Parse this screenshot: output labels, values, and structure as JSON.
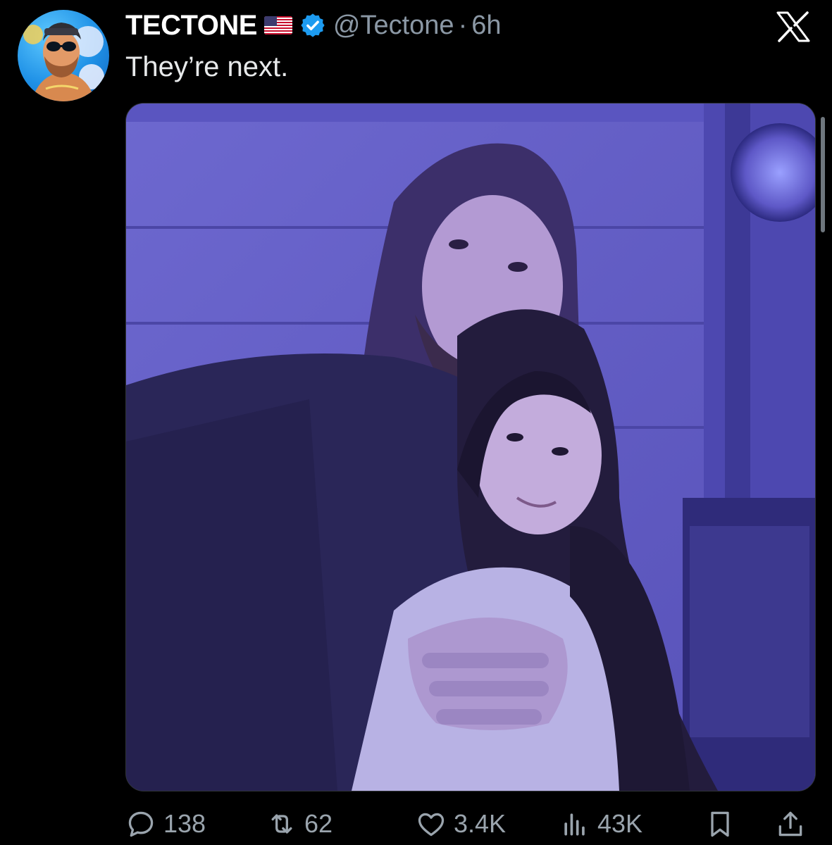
{
  "author": {
    "display_name": "TECTONE",
    "handle": "@Tectone",
    "separator": "·",
    "time": "6h",
    "flag": "us-flag-icon",
    "verified": "verified-badge-icon"
  },
  "tweet": {
    "text": "They’re next."
  },
  "brand": {
    "logo": "x-logo-icon"
  },
  "actions": {
    "replies": "138",
    "reposts": "62",
    "likes": "3.4K",
    "views": "43K"
  },
  "colors": {
    "background": "#000000",
    "text": "#e7e9ea",
    "secondary_text": "#8b98a5",
    "verified_blue": "#1d9bf0",
    "media_tint": "#6b66c9"
  }
}
